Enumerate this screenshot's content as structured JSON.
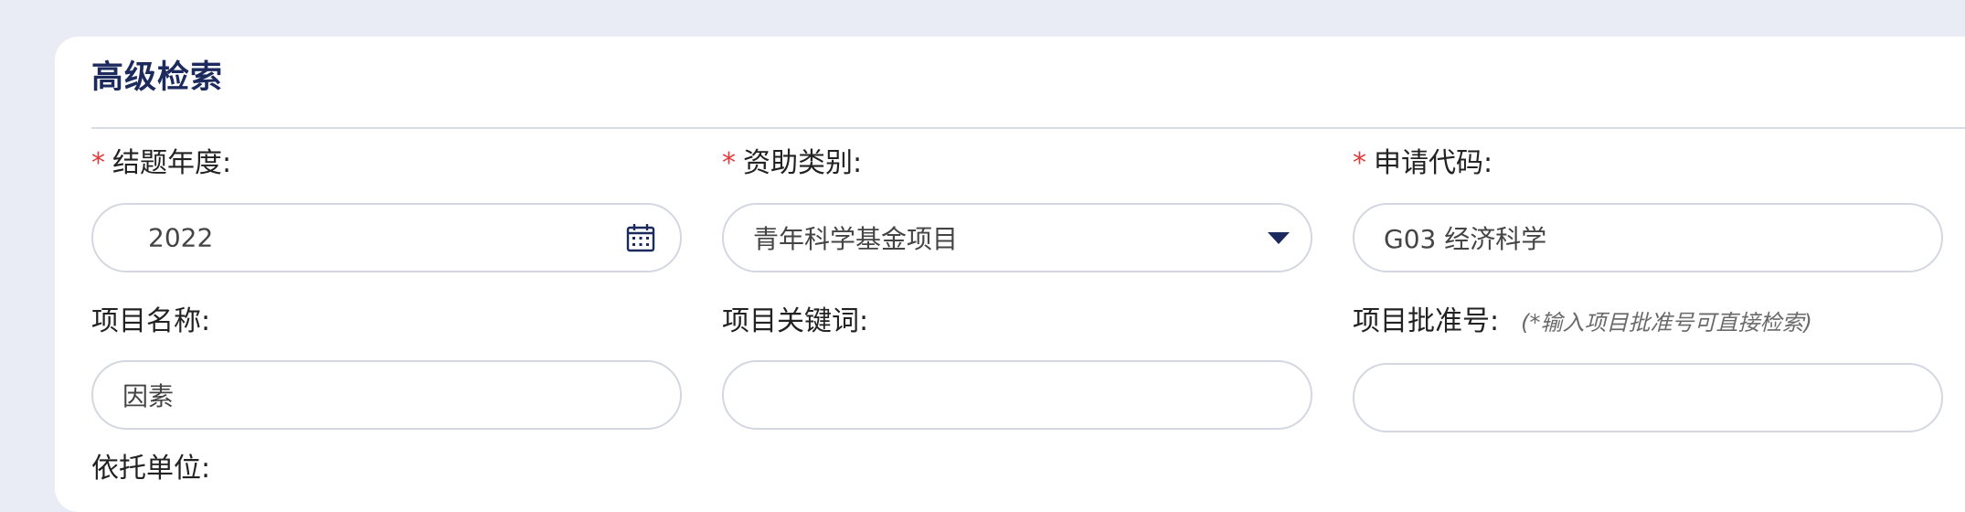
{
  "panel": {
    "title": "高级检索"
  },
  "fields": {
    "year": {
      "required_mark": "*",
      "label": "结题年度:",
      "value": "2022",
      "icon": "calendar-icon"
    },
    "funding_category": {
      "required_mark": "*",
      "label": "资助类别:",
      "value": "青年科学基金项目",
      "icon": "caret-down-icon"
    },
    "application_code": {
      "required_mark": "*",
      "label": "申请代码:",
      "value": "G03 经济科学"
    },
    "project_name": {
      "label": "项目名称:",
      "value": "因素"
    },
    "project_keywords": {
      "label": "项目关键词:",
      "value": ""
    },
    "project_approval_number": {
      "label": "项目批准号:",
      "hint": "(*输入项目批准号可直接检索)",
      "value": ""
    },
    "supporting_unit": {
      "label": "依托单位:"
    }
  },
  "colors": {
    "background": "#e9ecf5",
    "title": "#1c2a5e",
    "required": "#e23b3b",
    "icon": "#1c2a5e",
    "field_border": "#d4d7e1"
  }
}
